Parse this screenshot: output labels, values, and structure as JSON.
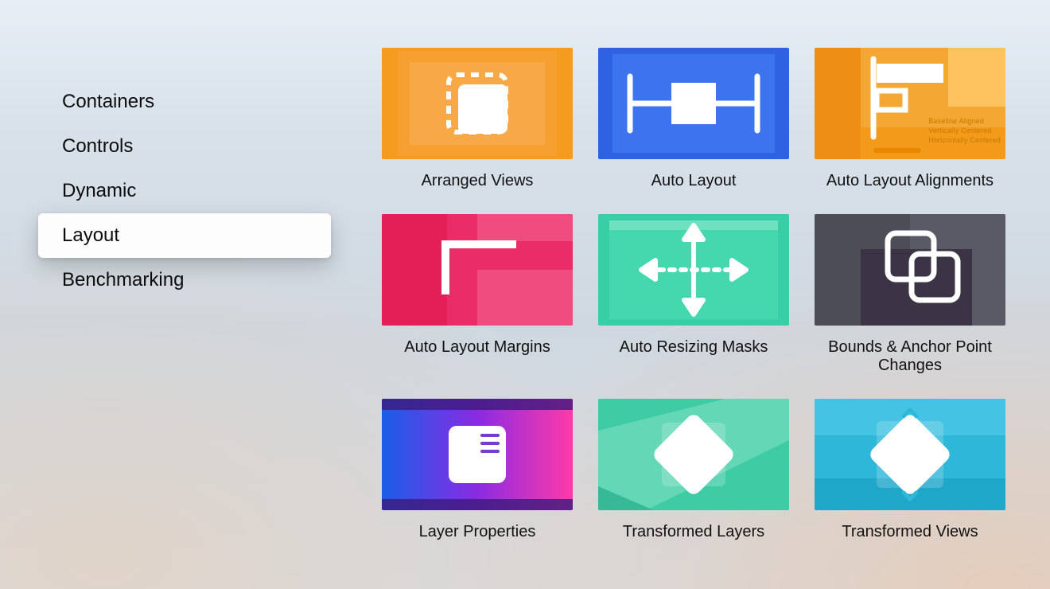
{
  "sidebar": {
    "items": [
      {
        "label": "Containers",
        "selected": false
      },
      {
        "label": "Controls",
        "selected": false
      },
      {
        "label": "Dynamic",
        "selected": false
      },
      {
        "label": "Layout",
        "selected": true
      },
      {
        "label": "Benchmarking",
        "selected": false
      }
    ]
  },
  "grid": {
    "items": [
      {
        "id": "arranged-views",
        "label": "Arranged Views",
        "icon": "stack-dashed-icon"
      },
      {
        "id": "auto-layout",
        "label": "Auto Layout",
        "icon": "constraint-width-icon"
      },
      {
        "id": "auto-layout-align",
        "label": "Auto Layout Alignments",
        "icon": "alignment-icon",
        "detail_lines": [
          "Baseline Aligned",
          "Vertically Centered",
          "Horizontally Centered"
        ]
      },
      {
        "id": "auto-layout-margins",
        "label": "Auto Layout Margins",
        "icon": "margin-corner-icon"
      },
      {
        "id": "auto-resizing-masks",
        "label": "Auto Resizing Masks",
        "icon": "resize-arrows-icon"
      },
      {
        "id": "bounds-anchor",
        "label": "Bounds & Anchor Point Changes",
        "icon": "overlap-squares-icon"
      },
      {
        "id": "layer-properties",
        "label": "Layer Properties",
        "icon": "layer-card-icon"
      },
      {
        "id": "transformed-layers",
        "label": "Transformed Layers",
        "icon": "diamond-icon"
      },
      {
        "id": "transformed-views",
        "label": "Transformed Views",
        "icon": "diamond-corners-icon"
      }
    ]
  }
}
